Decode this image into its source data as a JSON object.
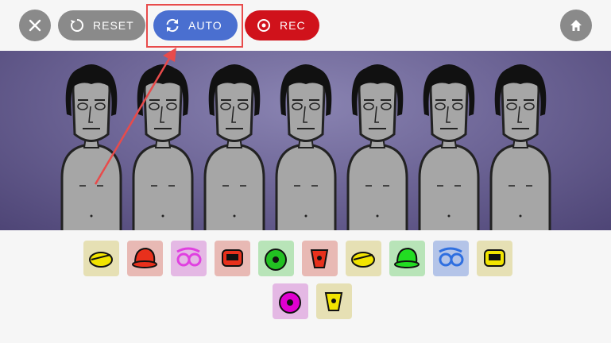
{
  "toolbar": {
    "close_icon": "close-icon",
    "reset_label": "RESET",
    "auto_label": "AUTO",
    "rec_label": "REC",
    "home_icon": "home-icon"
  },
  "colors": {
    "button_gray": "#8a8a8a",
    "auto_blue": "#4a6fd0",
    "rec_red": "#d0121b",
    "highlight": "#e84b4b",
    "stage_purple": "#6f6798"
  },
  "characters_count_label": "",
  "sound_icons": [
    {
      "name": "beat-icon-1",
      "bg": "#e6e0b4",
      "color": "#f2e400"
    },
    {
      "name": "beat-icon-2",
      "bg": "#e8b9b4",
      "color": "#e8301c"
    },
    {
      "name": "beat-icon-3",
      "bg": "#e4b8e4",
      "color": "#e040e0"
    },
    {
      "name": "beat-icon-4",
      "bg": "#e8b9b4",
      "color": "#e8301c"
    },
    {
      "name": "effect-icon-1",
      "bg": "#b8e4b8",
      "color": "#22c022"
    },
    {
      "name": "effect-icon-2",
      "bg": "#e8b9b4",
      "color": "#e8301c"
    },
    {
      "name": "melody-icon-1",
      "bg": "#e6e0b4",
      "color": "#f2e400"
    },
    {
      "name": "melody-icon-2",
      "bg": "#b8e4b8",
      "color": "#22dd22"
    },
    {
      "name": "melody-icon-3",
      "bg": "#b4c4e8",
      "color": "#2f6fe0"
    },
    {
      "name": "voice-icon-1",
      "bg": "#e6e0b4",
      "color": "#f2e400"
    },
    {
      "name": "voice-icon-2",
      "bg": "#e4b8e4",
      "color": "#e000d0"
    },
    {
      "name": "voice-icon-3",
      "bg": "#e6e0b4",
      "color": "#f2e400"
    }
  ]
}
